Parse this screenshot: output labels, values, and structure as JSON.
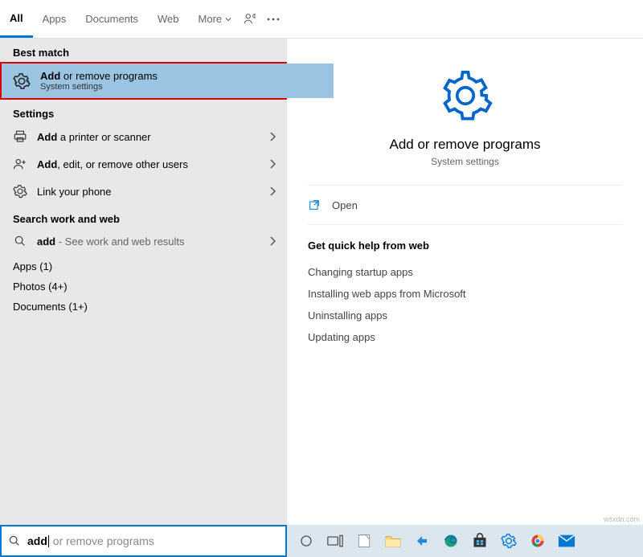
{
  "tabs": {
    "all": "All",
    "apps": "Apps",
    "documents": "Documents",
    "web": "Web",
    "more": "More"
  },
  "sections": {
    "best_match": "Best match",
    "settings": "Settings",
    "search_web": "Search work and web",
    "apps_count": "Apps (1)",
    "photos_count": "Photos (4+)",
    "documents_count": "Documents (1+)"
  },
  "best_match": {
    "title_bold": "Add",
    "title_rest": " or remove programs",
    "subtitle": "System settings"
  },
  "settings_items": {
    "printer_bold": "Add",
    "printer_rest": " a printer or scanner",
    "users_bold": "Add",
    "users_rest": ", edit, or remove other users",
    "link_phone": "Link your phone"
  },
  "web_item": {
    "bold": "add",
    "rest": " - See work and web results"
  },
  "detail": {
    "title": "Add or remove programs",
    "subtitle": "System settings",
    "open": "Open",
    "help_title": "Get quick help from web",
    "help_links": {
      "h1": "Changing startup apps",
      "h2": "Installing web apps from Microsoft",
      "h3": "Uninstalling apps",
      "h4": "Updating apps"
    }
  },
  "search": {
    "typed": "add",
    "placeholder_rest": " or remove programs"
  },
  "watermark": "wsxdn.com"
}
